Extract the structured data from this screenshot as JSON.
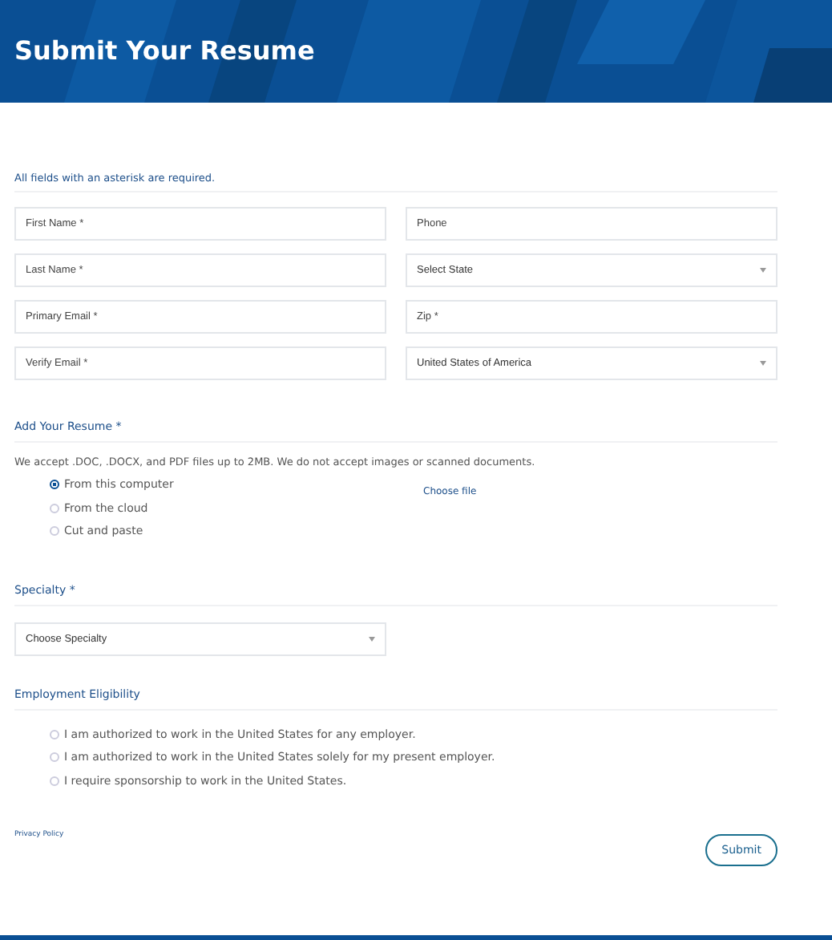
{
  "header": {
    "title": "Submit Your Resume"
  },
  "required_note": "All fields with an asterisk are required.",
  "fields": [
    {
      "kind": "input",
      "placeholder": "First Name *"
    },
    {
      "kind": "input",
      "placeholder": "Phone"
    },
    {
      "kind": "input",
      "placeholder": "Last Name *"
    },
    {
      "kind": "select",
      "value": "Select State"
    },
    {
      "kind": "input",
      "placeholder": "Primary Email *"
    },
    {
      "kind": "input",
      "placeholder": "Zip *"
    },
    {
      "kind": "input",
      "placeholder": "Verify Email *"
    },
    {
      "kind": "select",
      "value": "United States of America"
    }
  ],
  "resume": {
    "heading": "Add Your Resume *",
    "description": "We accept .DOC, .DOCX, and PDF files up to 2MB. We do not accept images or scanned documents.",
    "options": [
      {
        "label": "From this computer",
        "selected": true
      },
      {
        "label": "From the cloud",
        "selected": false
      },
      {
        "label": "Cut and paste",
        "selected": false
      }
    ],
    "file_button": "Choose file"
  },
  "specialty": {
    "heading": "Specialty *",
    "value": "Choose Specialty"
  },
  "eligibility": {
    "heading": "Employment Eligibility",
    "options": [
      {
        "label": "I am authorized to work in the United States for any employer.",
        "selected": false
      },
      {
        "label": "I am authorized to work in the United States solely for my present employer.",
        "selected": false
      },
      {
        "label": "I require sponsorship to work in the United States.",
        "selected": false
      }
    ]
  },
  "privacy_link": "Privacy Policy",
  "submit": "Submit"
}
